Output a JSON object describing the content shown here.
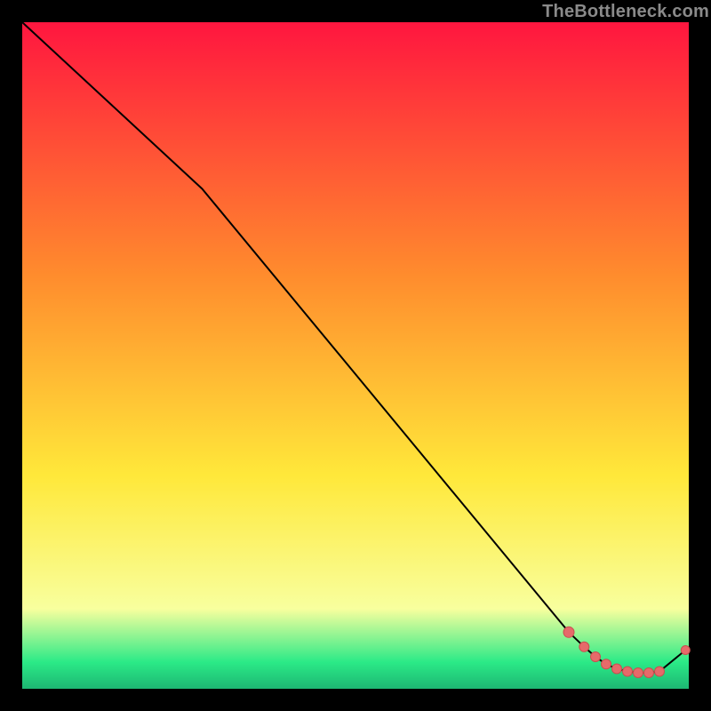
{
  "watermark": "TheBottleneck.com",
  "colors": {
    "top": "#ff163f",
    "orange": "#ff8c2d",
    "yellow": "#ffe83a",
    "paleYellow": "#f8ff9e",
    "green": "#2bea87",
    "deepGreen": "#1db773",
    "lineBlack": "#000000",
    "dotFill": "#e66a6a",
    "dotStroke": "#c94f4f"
  },
  "chart_data": {
    "type": "line",
    "title": "",
    "xlabel": "",
    "ylabel": "",
    "xlim": [
      0,
      100
    ],
    "ylim": [
      0,
      100
    ],
    "grid": false,
    "series": [
      {
        "name": "curve",
        "x": [
          0,
          27,
          82,
          84.3,
          86.0,
          87.6,
          89.2,
          90.8,
          92.4,
          94.0,
          95.6,
          99.5
        ],
        "y": [
          100,
          75,
          8.5,
          6.3,
          4.8,
          3.7,
          3.0,
          2.6,
          2.4,
          2.4,
          2.6,
          5.8
        ]
      }
    ],
    "markers": {
      "name": "dots",
      "x": [
        82,
        84.3,
        86.0,
        87.6,
        89.2,
        90.8,
        92.4,
        94.0,
        95.6,
        99.5
      ],
      "y": [
        8.5,
        6.3,
        4.8,
        3.7,
        3.0,
        2.6,
        2.4,
        2.4,
        2.6,
        5.8
      ],
      "r": [
        6,
        5.5,
        5.5,
        5.5,
        5.5,
        5.5,
        5.5,
        5.5,
        5.5,
        5.0
      ]
    }
  }
}
